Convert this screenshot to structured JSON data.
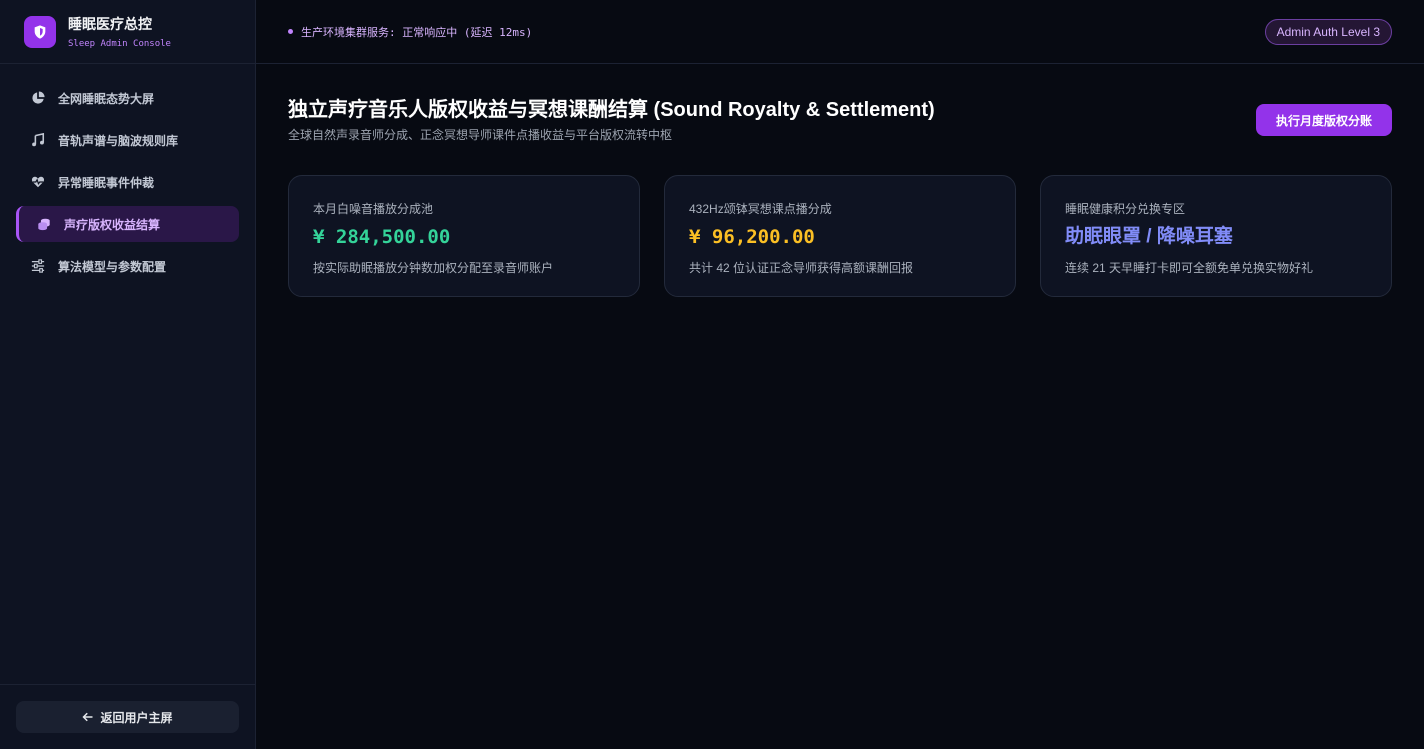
{
  "brand": {
    "title": "睡眠医疗总控",
    "subtitle": "Sleep Admin Console"
  },
  "sidebar": {
    "items": [
      {
        "label": "全网睡眠态势大屏",
        "icon": "pie-chart-icon"
      },
      {
        "label": "音轨声谱与脑波规则库",
        "icon": "music-icon"
      },
      {
        "label": "异常睡眠事件仲裁",
        "icon": "heart-pulse-icon"
      },
      {
        "label": "声疗版权收益结算",
        "icon": "coins-icon",
        "active": true
      },
      {
        "label": "算法模型与参数配置",
        "icon": "sliders-icon"
      }
    ],
    "back_label": "返回用户主屏"
  },
  "topbar": {
    "status": "生产环境集群服务: 正常响应中 (延迟 12ms)",
    "auth_badge": "Admin Auth Level 3"
  },
  "main": {
    "title": "独立声疗音乐人版权收益与冥想课酬结算 (Sound Royalty & Settlement)",
    "subtitle": "全球自然声录音师分成、正念冥想导师课件点播收益与平台版权流转中枢",
    "action_label": "执行月度版权分账"
  },
  "cards": [
    {
      "label": "本月白噪音播放分成池",
      "value": "¥ 284,500.00",
      "desc": "按实际助眠播放分钟数加权分配至录音师账户",
      "color": "#34d399"
    },
    {
      "label": "432Hz颂钵冥想课点播分成",
      "value": "¥ 96,200.00",
      "desc": "共计 42 位认证正念导师获得高额课酬回报",
      "color": "#fbbf24"
    },
    {
      "label": "睡眠健康积分兑换专区",
      "value": "助眠眼罩 / 降噪耳塞",
      "desc": "连续 21 天早睡打卡即可全额免单兑换实物好礼",
      "color": "#818cf8"
    }
  ]
}
